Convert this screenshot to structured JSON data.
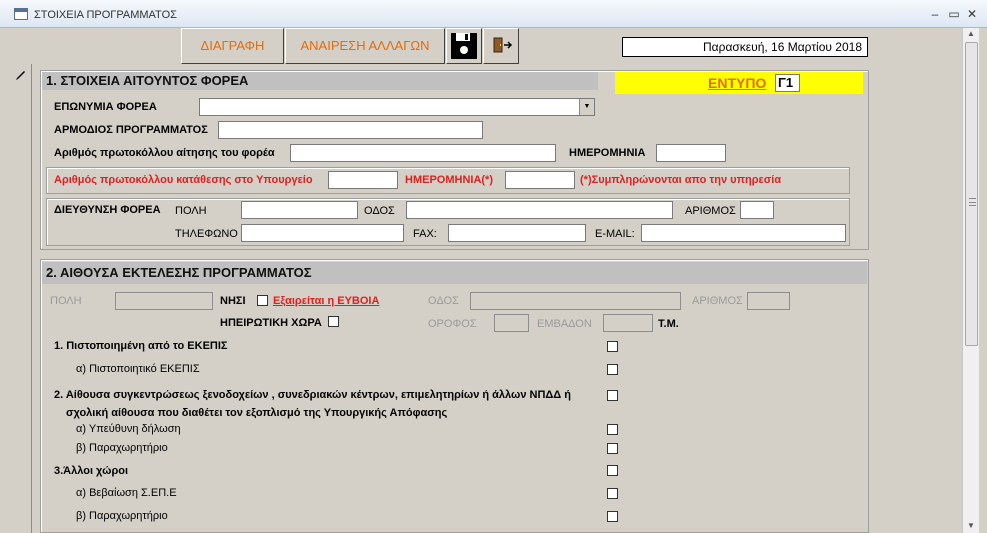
{
  "window": {
    "title": "ΣΤΟΙΧΕΙΑ ΠΡΟΓΡΑΜΜΑΤΟΣ",
    "min": "–",
    "max": "▭",
    "close": "✕"
  },
  "toolbar": {
    "delete_label": "ΔΙΑΓΡΑΦΗ",
    "undo_label": "ΑΝΑΙΡΕΣΗ ΑΛΛΑΓΩΝ",
    "date": "Παρασκευή, 16 Μαρτίου 2018"
  },
  "section1": {
    "title": "1. ΣΤΟΙΧΕΙΑ ΑΙΤΟΥΝΤΟΣ ΦΟΡΕΑ",
    "form_label": "ΕΝΤΥΠΟ",
    "form_value": "Γ1",
    "org_name_label": "ΕΠΩΝΥΜΙΑ ΦΟΡΕΑ",
    "program_manager_label": "ΑΡΜΟΔΙΟΣ ΠΡΟΓΡΑΜΜΑΤΟΣ",
    "protocol_label": "Αριθμός πρωτοκόλλου αίτησης του φορέα",
    "date_label": "ΗΜΕΡΟΜΗΝΙΑ",
    "ministry_protocol_label": "Αριθμός πρωτοκόλλου κατάθεσης στο Υπουργείο",
    "ministry_date_label": "ΗΜΕΡΟΜΗΝΙΑ(*)",
    "service_note": "(*)Συμπληρώνονται απο την υπηρεσία",
    "address_label": "ΔΙΕΥΘΥΝΣΗ ΦΟΡΕΑ",
    "city_label": "ΠΟΛΗ",
    "street_label": "ΟΔΟΣ",
    "number_label": "ΑΡΙΘΜΟΣ",
    "phone_label": "ΤΗΛΕΦΩΝΟ",
    "fax_label": "FAX:",
    "email_label": "E-MAIL:"
  },
  "section2": {
    "title": "2. ΑΙΘΟΥΣΑ ΕΚΤΕΛΕΣΗΣ ΠΡΟΓΡΑΜΜΑΤΟΣ",
    "city_label": "ΠΟΛΗ",
    "island_label": "ΝΗΣΙ",
    "euboea_label": "Εξαιρείται η ΕΥΒΟΙΑ",
    "mainland_label": "ΗΠΕΙΡΩΤΙΚΗ  ΧΩΡΑ",
    "street_label": "ΟΔΟΣ",
    "number_label": "ΑΡΙΘΜΟΣ",
    "floor_label": "ΟΡΟΦΟΣ",
    "area_label": "ΕΜΒΑΔΟΝ",
    "sqm_label": "Τ.Μ.",
    "item1": "1. Πιστοποιημένη από το ΕΚΕΠΙΣ",
    "item1a": "α) Πιστοποιητικό ΕΚΕΠΙΣ",
    "item2_line1": "2. Αίθουσα συγκεντρώσεως ξενοδοχείων , συνεδριακών κέντρων, επιμελητηρίων ή άλλων ΝΠΔΔ ή",
    "item2_line2": "σχολική αίθουσα που διαθέτει τον εξοπλισμό της  Υπουργικής Απόφασης",
    "item2a": "α) Υπεύθυνη δήλωση",
    "item2b": "β) Παραχωρητήριο",
    "item3": "3.Άλλοι χώροι",
    "item3a": "α) Βεβαίωση Σ.ΕΠ.Ε",
    "item3b": "β) Παραχωρητήριο"
  }
}
